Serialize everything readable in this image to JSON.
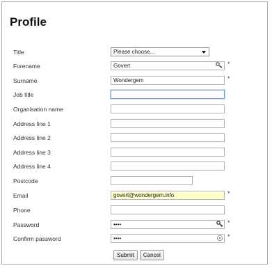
{
  "page": {
    "title": "Profile"
  },
  "form": {
    "required_mark": "*",
    "title": {
      "label": "Title",
      "selected": "Please choose..."
    },
    "forename": {
      "label": "Forename",
      "value": "Govert"
    },
    "surname": {
      "label": "Surname",
      "value": "Wondergem"
    },
    "job_title": {
      "label": "Job title",
      "value": ""
    },
    "organisation_name": {
      "label": "Organisation name",
      "value": ""
    },
    "address_line_1": {
      "label": "Address line 1",
      "value": ""
    },
    "address_line_2": {
      "label": "Address line 2",
      "value": ""
    },
    "address_line_3": {
      "label": "Address line 3",
      "value": ""
    },
    "address_line_4": {
      "label": "Address line 4",
      "value": ""
    },
    "postcode": {
      "label": "Postcode",
      "value": ""
    },
    "email": {
      "label": "Email",
      "value": "govert@wondergem.info"
    },
    "phone": {
      "label": "Phone",
      "value": ""
    },
    "password": {
      "label": "Password",
      "value": "••••"
    },
    "confirm_password": {
      "label": "Confirm password",
      "value": "••••"
    }
  },
  "actions": {
    "submit_label": "Submit",
    "cancel_label": "Cancel"
  },
  "colors": {
    "highlight_field": "#ffffc9",
    "focus_border": "#6fa0d8"
  },
  "icons": {
    "autofill": "key-autofill-icon",
    "reveal": "eye-icon"
  }
}
